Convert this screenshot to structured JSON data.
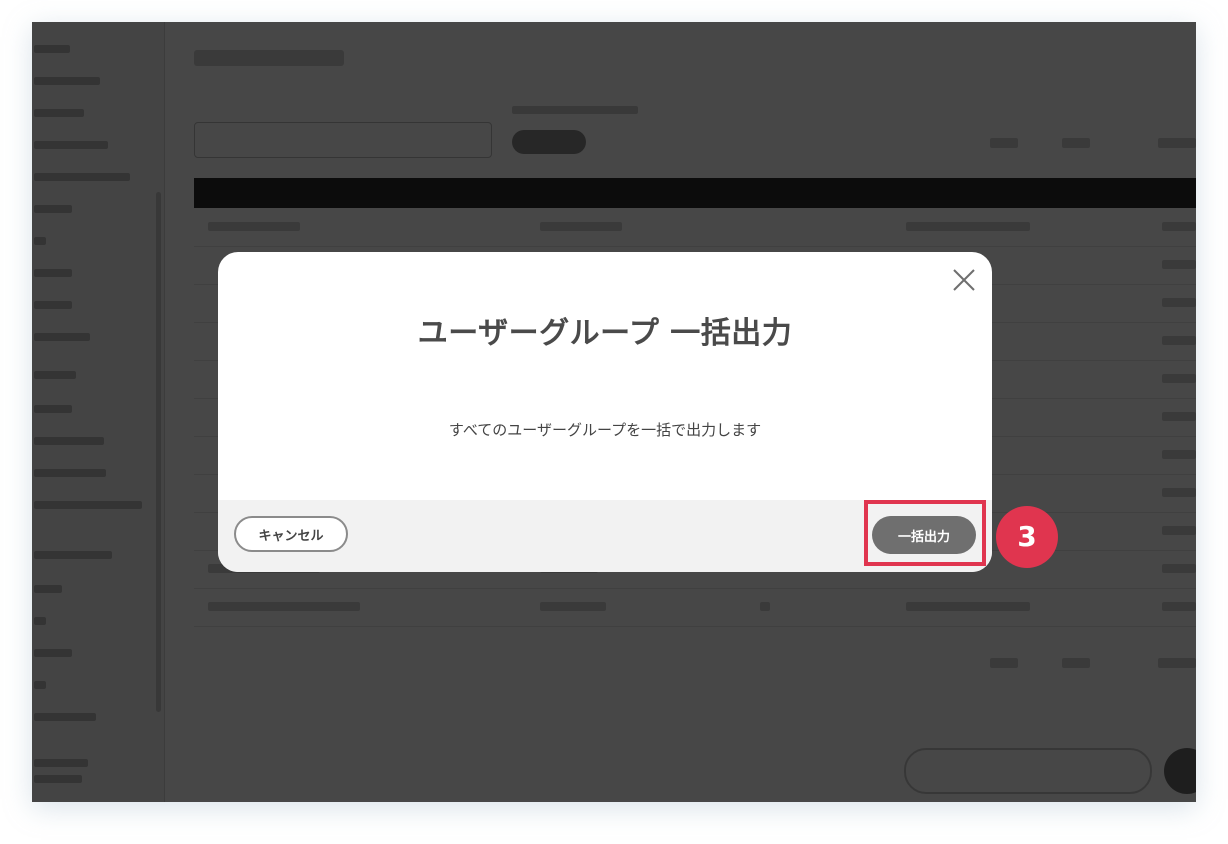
{
  "dialog": {
    "title": "ユーザーグループ 一括出力",
    "message": "すべてのユーザーグループを一括で出力します",
    "cancel_label": "キャンセル",
    "export_label": "一括出力"
  },
  "annotation": {
    "step_number": "3"
  },
  "icons": {
    "close": "close-icon"
  },
  "colors": {
    "overlay": "#000000",
    "highlight": "#e0354f",
    "primary_button": "#6f6f6f",
    "title_text": "#4a4a4a"
  }
}
